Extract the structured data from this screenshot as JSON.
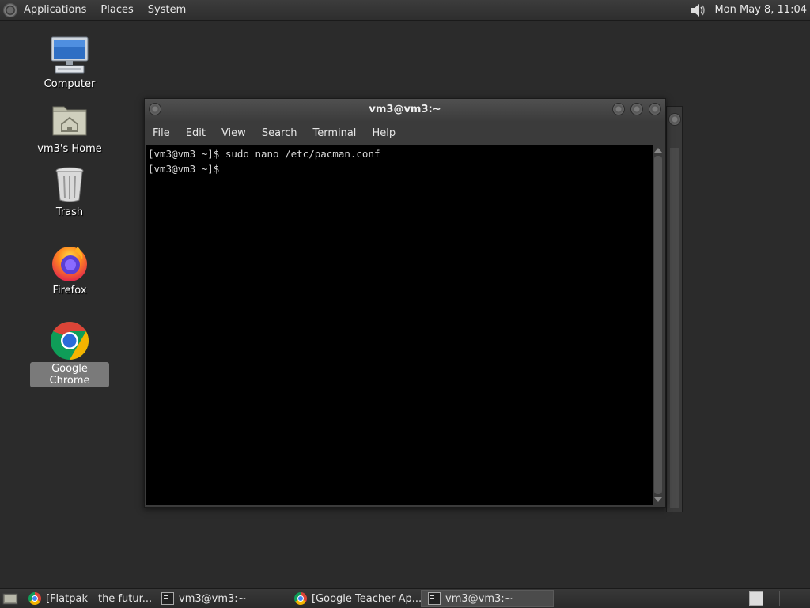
{
  "top_panel": {
    "applications": "Applications",
    "places": "Places",
    "system": "System",
    "clock": "Mon May  8, 11:04"
  },
  "desktop": {
    "icons": [
      {
        "label": "Computer",
        "icon": "computer-icon"
      },
      {
        "label": "vm3's Home",
        "icon": "home-folder-icon"
      },
      {
        "label": "Trash",
        "icon": "trash-icon"
      },
      {
        "label": "Firefox",
        "icon": "firefox-icon"
      },
      {
        "label": "Google Chrome",
        "icon": "chrome-icon",
        "selected": true
      }
    ]
  },
  "terminal": {
    "title": "vm3@vm3:~",
    "menu": [
      "File",
      "Edit",
      "View",
      "Search",
      "Terminal",
      "Help"
    ],
    "lines": [
      "[vm3@vm3 ~]$ sudo nano /etc/pacman.conf",
      "[vm3@vm3 ~]$"
    ]
  },
  "taskbar": {
    "tasks": [
      {
        "label": "[Flatpak—the futur...",
        "icon": "chrome-icon",
        "active": false
      },
      {
        "label": "vm3@vm3:~",
        "icon": "terminal-icon",
        "active": false
      },
      {
        "label": "[Google Teacher Ap...",
        "icon": "chrome-icon",
        "active": false
      },
      {
        "label": "vm3@vm3:~",
        "icon": "terminal-icon",
        "active": true
      }
    ]
  }
}
